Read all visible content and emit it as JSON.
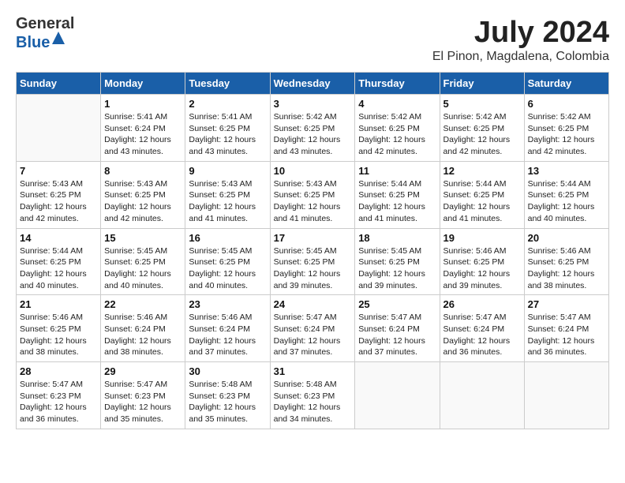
{
  "header": {
    "logo_general": "General",
    "logo_blue": "Blue",
    "month_year": "July 2024",
    "location": "El Pinon, Magdalena, Colombia"
  },
  "days_of_week": [
    "Sunday",
    "Monday",
    "Tuesday",
    "Wednesday",
    "Thursday",
    "Friday",
    "Saturday"
  ],
  "weeks": [
    [
      {
        "day": "",
        "info": ""
      },
      {
        "day": "1",
        "info": "Sunrise: 5:41 AM\nSunset: 6:24 PM\nDaylight: 12 hours\nand 43 minutes."
      },
      {
        "day": "2",
        "info": "Sunrise: 5:41 AM\nSunset: 6:25 PM\nDaylight: 12 hours\nand 43 minutes."
      },
      {
        "day": "3",
        "info": "Sunrise: 5:42 AM\nSunset: 6:25 PM\nDaylight: 12 hours\nand 43 minutes."
      },
      {
        "day": "4",
        "info": "Sunrise: 5:42 AM\nSunset: 6:25 PM\nDaylight: 12 hours\nand 42 minutes."
      },
      {
        "day": "5",
        "info": "Sunrise: 5:42 AM\nSunset: 6:25 PM\nDaylight: 12 hours\nand 42 minutes."
      },
      {
        "day": "6",
        "info": "Sunrise: 5:42 AM\nSunset: 6:25 PM\nDaylight: 12 hours\nand 42 minutes."
      }
    ],
    [
      {
        "day": "7",
        "info": "Sunrise: 5:43 AM\nSunset: 6:25 PM\nDaylight: 12 hours\nand 42 minutes."
      },
      {
        "day": "8",
        "info": "Sunrise: 5:43 AM\nSunset: 6:25 PM\nDaylight: 12 hours\nand 42 minutes."
      },
      {
        "day": "9",
        "info": "Sunrise: 5:43 AM\nSunset: 6:25 PM\nDaylight: 12 hours\nand 41 minutes."
      },
      {
        "day": "10",
        "info": "Sunrise: 5:43 AM\nSunset: 6:25 PM\nDaylight: 12 hours\nand 41 minutes."
      },
      {
        "day": "11",
        "info": "Sunrise: 5:44 AM\nSunset: 6:25 PM\nDaylight: 12 hours\nand 41 minutes."
      },
      {
        "day": "12",
        "info": "Sunrise: 5:44 AM\nSunset: 6:25 PM\nDaylight: 12 hours\nand 41 minutes."
      },
      {
        "day": "13",
        "info": "Sunrise: 5:44 AM\nSunset: 6:25 PM\nDaylight: 12 hours\nand 40 minutes."
      }
    ],
    [
      {
        "day": "14",
        "info": "Sunrise: 5:44 AM\nSunset: 6:25 PM\nDaylight: 12 hours\nand 40 minutes."
      },
      {
        "day": "15",
        "info": "Sunrise: 5:45 AM\nSunset: 6:25 PM\nDaylight: 12 hours\nand 40 minutes."
      },
      {
        "day": "16",
        "info": "Sunrise: 5:45 AM\nSunset: 6:25 PM\nDaylight: 12 hours\nand 40 minutes."
      },
      {
        "day": "17",
        "info": "Sunrise: 5:45 AM\nSunset: 6:25 PM\nDaylight: 12 hours\nand 39 minutes."
      },
      {
        "day": "18",
        "info": "Sunrise: 5:45 AM\nSunset: 6:25 PM\nDaylight: 12 hours\nand 39 minutes."
      },
      {
        "day": "19",
        "info": "Sunrise: 5:46 AM\nSunset: 6:25 PM\nDaylight: 12 hours\nand 39 minutes."
      },
      {
        "day": "20",
        "info": "Sunrise: 5:46 AM\nSunset: 6:25 PM\nDaylight: 12 hours\nand 38 minutes."
      }
    ],
    [
      {
        "day": "21",
        "info": "Sunrise: 5:46 AM\nSunset: 6:25 PM\nDaylight: 12 hours\nand 38 minutes."
      },
      {
        "day": "22",
        "info": "Sunrise: 5:46 AM\nSunset: 6:24 PM\nDaylight: 12 hours\nand 38 minutes."
      },
      {
        "day": "23",
        "info": "Sunrise: 5:46 AM\nSunset: 6:24 PM\nDaylight: 12 hours\nand 37 minutes."
      },
      {
        "day": "24",
        "info": "Sunrise: 5:47 AM\nSunset: 6:24 PM\nDaylight: 12 hours\nand 37 minutes."
      },
      {
        "day": "25",
        "info": "Sunrise: 5:47 AM\nSunset: 6:24 PM\nDaylight: 12 hours\nand 37 minutes."
      },
      {
        "day": "26",
        "info": "Sunrise: 5:47 AM\nSunset: 6:24 PM\nDaylight: 12 hours\nand 36 minutes."
      },
      {
        "day": "27",
        "info": "Sunrise: 5:47 AM\nSunset: 6:24 PM\nDaylight: 12 hours\nand 36 minutes."
      }
    ],
    [
      {
        "day": "28",
        "info": "Sunrise: 5:47 AM\nSunset: 6:23 PM\nDaylight: 12 hours\nand 36 minutes."
      },
      {
        "day": "29",
        "info": "Sunrise: 5:47 AM\nSunset: 6:23 PM\nDaylight: 12 hours\nand 35 minutes."
      },
      {
        "day": "30",
        "info": "Sunrise: 5:48 AM\nSunset: 6:23 PM\nDaylight: 12 hours\nand 35 minutes."
      },
      {
        "day": "31",
        "info": "Sunrise: 5:48 AM\nSunset: 6:23 PM\nDaylight: 12 hours\nand 34 minutes."
      },
      {
        "day": "",
        "info": ""
      },
      {
        "day": "",
        "info": ""
      },
      {
        "day": "",
        "info": ""
      }
    ]
  ]
}
